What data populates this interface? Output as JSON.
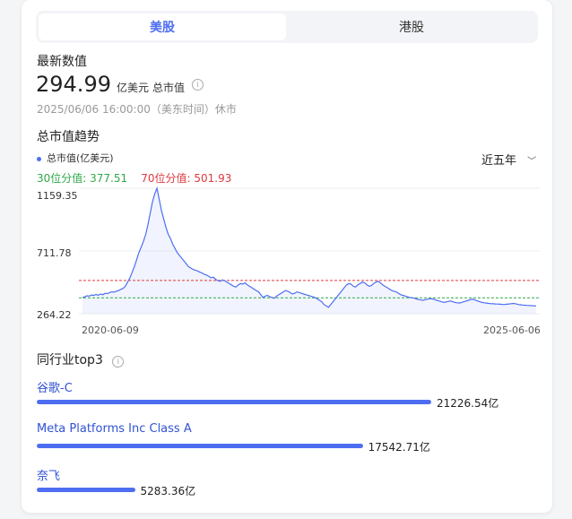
{
  "tabs": [
    "美股",
    "港股"
  ],
  "latest": {
    "label": "最新数值",
    "value": "294.99",
    "unit": "亿美元",
    "metric": "总市值",
    "timestamp": "2025/06/06 16:00:00（美东时间）休市"
  },
  "trend": {
    "title": "总市值趋势",
    "legend": "总市值(亿美元)",
    "p30_label": "30位分值: 377.51",
    "p70_label": "70位分值: 501.93",
    "range_select": "近五年"
  },
  "chart_data": {
    "type": "area",
    "y_ticks": [
      "1159.35",
      "711.78",
      "264.22"
    ],
    "ylim": [
      264.22,
      1159.35
    ],
    "x_labels": [
      "2020-06-09",
      "2025-06-06"
    ],
    "p30": 377.51,
    "p70": 501.93,
    "colors": {
      "line": "#4e6ef2",
      "p30": "#2fa84a",
      "p70": "#e0393e"
    },
    "series": [
      {
        "values": [
          380,
          385,
          392,
          390,
          398,
          395,
          402,
          396,
          405,
          400,
          410,
          408,
          415,
          420,
          418,
          425,
          430,
          438,
          445,
          460,
          490,
          520,
          560,
          600,
          650,
          700,
          740,
          780,
          830,
          900,
          980,
          1060,
          1120,
          1159,
          1080,
          1000,
          940,
          880,
          830,
          800,
          760,
          730,
          700,
          680,
          660,
          640,
          620,
          600,
          590,
          580,
          575,
          570,
          560,
          555,
          545,
          540,
          530,
          520,
          525,
          510,
          500,
          495,
          505,
          500,
          490,
          480,
          470,
          460,
          455,
          470,
          480,
          475,
          485,
          470,
          460,
          450,
          440,
          430,
          420,
          400,
          380,
          390,
          395,
          385,
          380,
          375,
          390,
          400,
          410,
          420,
          430,
          425,
          415,
          405,
          410,
          420,
          415,
          410,
          405,
          400,
          395,
          390,
          385,
          380,
          370,
          360,
          350,
          330,
          320,
          310,
          330,
          350,
          370,
          390,
          410,
          430,
          450,
          470,
          480,
          475,
          460,
          455,
          470,
          480,
          490,
          485,
          470,
          460,
          465,
          480,
          490,
          495,
          485,
          470,
          460,
          450,
          440,
          430,
          425,
          420,
          410,
          400,
          395,
          390,
          385,
          380,
          378,
          375,
          370,
          365,
          362,
          360,
          365,
          368,
          372,
          370,
          366,
          360,
          355,
          350,
          345,
          348,
          352,
          355,
          350,
          345,
          342,
          340,
          345,
          350,
          355,
          360,
          365,
          368,
          362,
          355,
          350,
          345,
          342,
          340,
          338,
          336,
          335,
          334,
          333,
          332,
          331,
          330,
          332,
          334,
          336,
          338,
          335,
          330,
          328,
          326,
          325,
          324,
          323,
          322,
          321,
          320
        ]
      }
    ]
  },
  "peers": {
    "title": "同行业top3",
    "items": [
      {
        "name": "谷歌-C",
        "value": 21226.54,
        "label": "21226.54亿"
      },
      {
        "name": "Meta Platforms Inc Class A",
        "value": 17542.71,
        "label": "17542.71亿"
      },
      {
        "name": "奈飞",
        "value": 5283.36,
        "label": "5283.36亿"
      }
    ]
  }
}
